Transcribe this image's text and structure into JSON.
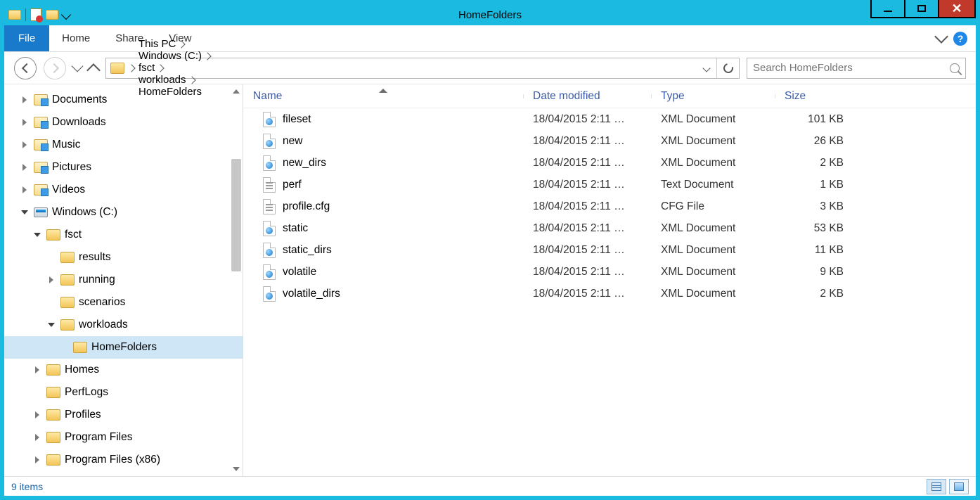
{
  "window": {
    "title": "HomeFolders"
  },
  "ribbon": {
    "file": "File",
    "tabs": [
      "Home",
      "Share",
      "View"
    ],
    "help": "?"
  },
  "breadcrumb": [
    "This PC",
    "Windows (C:)",
    "fsct",
    "workloads",
    "HomeFolders"
  ],
  "search": {
    "placeholder": "Search HomeFolders"
  },
  "tree": [
    {
      "label": "Documents",
      "level": 0,
      "icon": "lib",
      "exp": "right"
    },
    {
      "label": "Downloads",
      "level": 0,
      "icon": "lib",
      "exp": "right"
    },
    {
      "label": "Music",
      "level": 0,
      "icon": "lib",
      "exp": "right"
    },
    {
      "label": "Pictures",
      "level": 0,
      "icon": "lib",
      "exp": "right"
    },
    {
      "label": "Videos",
      "level": 0,
      "icon": "lib",
      "exp": "right"
    },
    {
      "label": "Windows (C:)",
      "level": 0,
      "icon": "drive",
      "exp": "down"
    },
    {
      "label": "fsct",
      "level": 1,
      "icon": "folder",
      "exp": "down"
    },
    {
      "label": "results",
      "level": 2,
      "icon": "folder",
      "exp": "none"
    },
    {
      "label": "running",
      "level": 2,
      "icon": "folder",
      "exp": "right"
    },
    {
      "label": "scenarios",
      "level": 2,
      "icon": "folder",
      "exp": "none"
    },
    {
      "label": "workloads",
      "level": 2,
      "icon": "folder",
      "exp": "down"
    },
    {
      "label": "HomeFolders",
      "level": 3,
      "icon": "folder",
      "exp": "none",
      "selected": true
    },
    {
      "label": "Homes",
      "level": 1,
      "icon": "folder",
      "exp": "right"
    },
    {
      "label": "PerfLogs",
      "level": 1,
      "icon": "folder",
      "exp": "none"
    },
    {
      "label": "Profiles",
      "level": 1,
      "icon": "folder",
      "exp": "right"
    },
    {
      "label": "Program Files",
      "level": 1,
      "icon": "folder",
      "exp": "right"
    },
    {
      "label": "Program Files (x86)",
      "level": 1,
      "icon": "folder",
      "exp": "right"
    }
  ],
  "columns": {
    "name": "Name",
    "date": "Date modified",
    "type": "Type",
    "size": "Size",
    "sort": "name"
  },
  "files": [
    {
      "name": "fileset",
      "date": "18/04/2015 2:11 …",
      "type": "XML Document",
      "size": "101 KB",
      "ico": "xml"
    },
    {
      "name": "new",
      "date": "18/04/2015 2:11 …",
      "type": "XML Document",
      "size": "26 KB",
      "ico": "xml"
    },
    {
      "name": "new_dirs",
      "date": "18/04/2015 2:11 …",
      "type": "XML Document",
      "size": "2 KB",
      "ico": "xml"
    },
    {
      "name": "perf",
      "date": "18/04/2015 2:11 …",
      "type": "Text Document",
      "size": "1 KB",
      "ico": "txt"
    },
    {
      "name": "profile.cfg",
      "date": "18/04/2015 2:11 …",
      "type": "CFG File",
      "size": "3 KB",
      "ico": "txt"
    },
    {
      "name": "static",
      "date": "18/04/2015 2:11 …",
      "type": "XML Document",
      "size": "53 KB",
      "ico": "xml"
    },
    {
      "name": "static_dirs",
      "date": "18/04/2015 2:11 …",
      "type": "XML Document",
      "size": "11 KB",
      "ico": "xml"
    },
    {
      "name": "volatile",
      "date": "18/04/2015 2:11 …",
      "type": "XML Document",
      "size": "9 KB",
      "ico": "xml"
    },
    {
      "name": "volatile_dirs",
      "date": "18/04/2015 2:11 …",
      "type": "XML Document",
      "size": "2 KB",
      "ico": "xml"
    }
  ],
  "status": {
    "text": "9 items"
  }
}
